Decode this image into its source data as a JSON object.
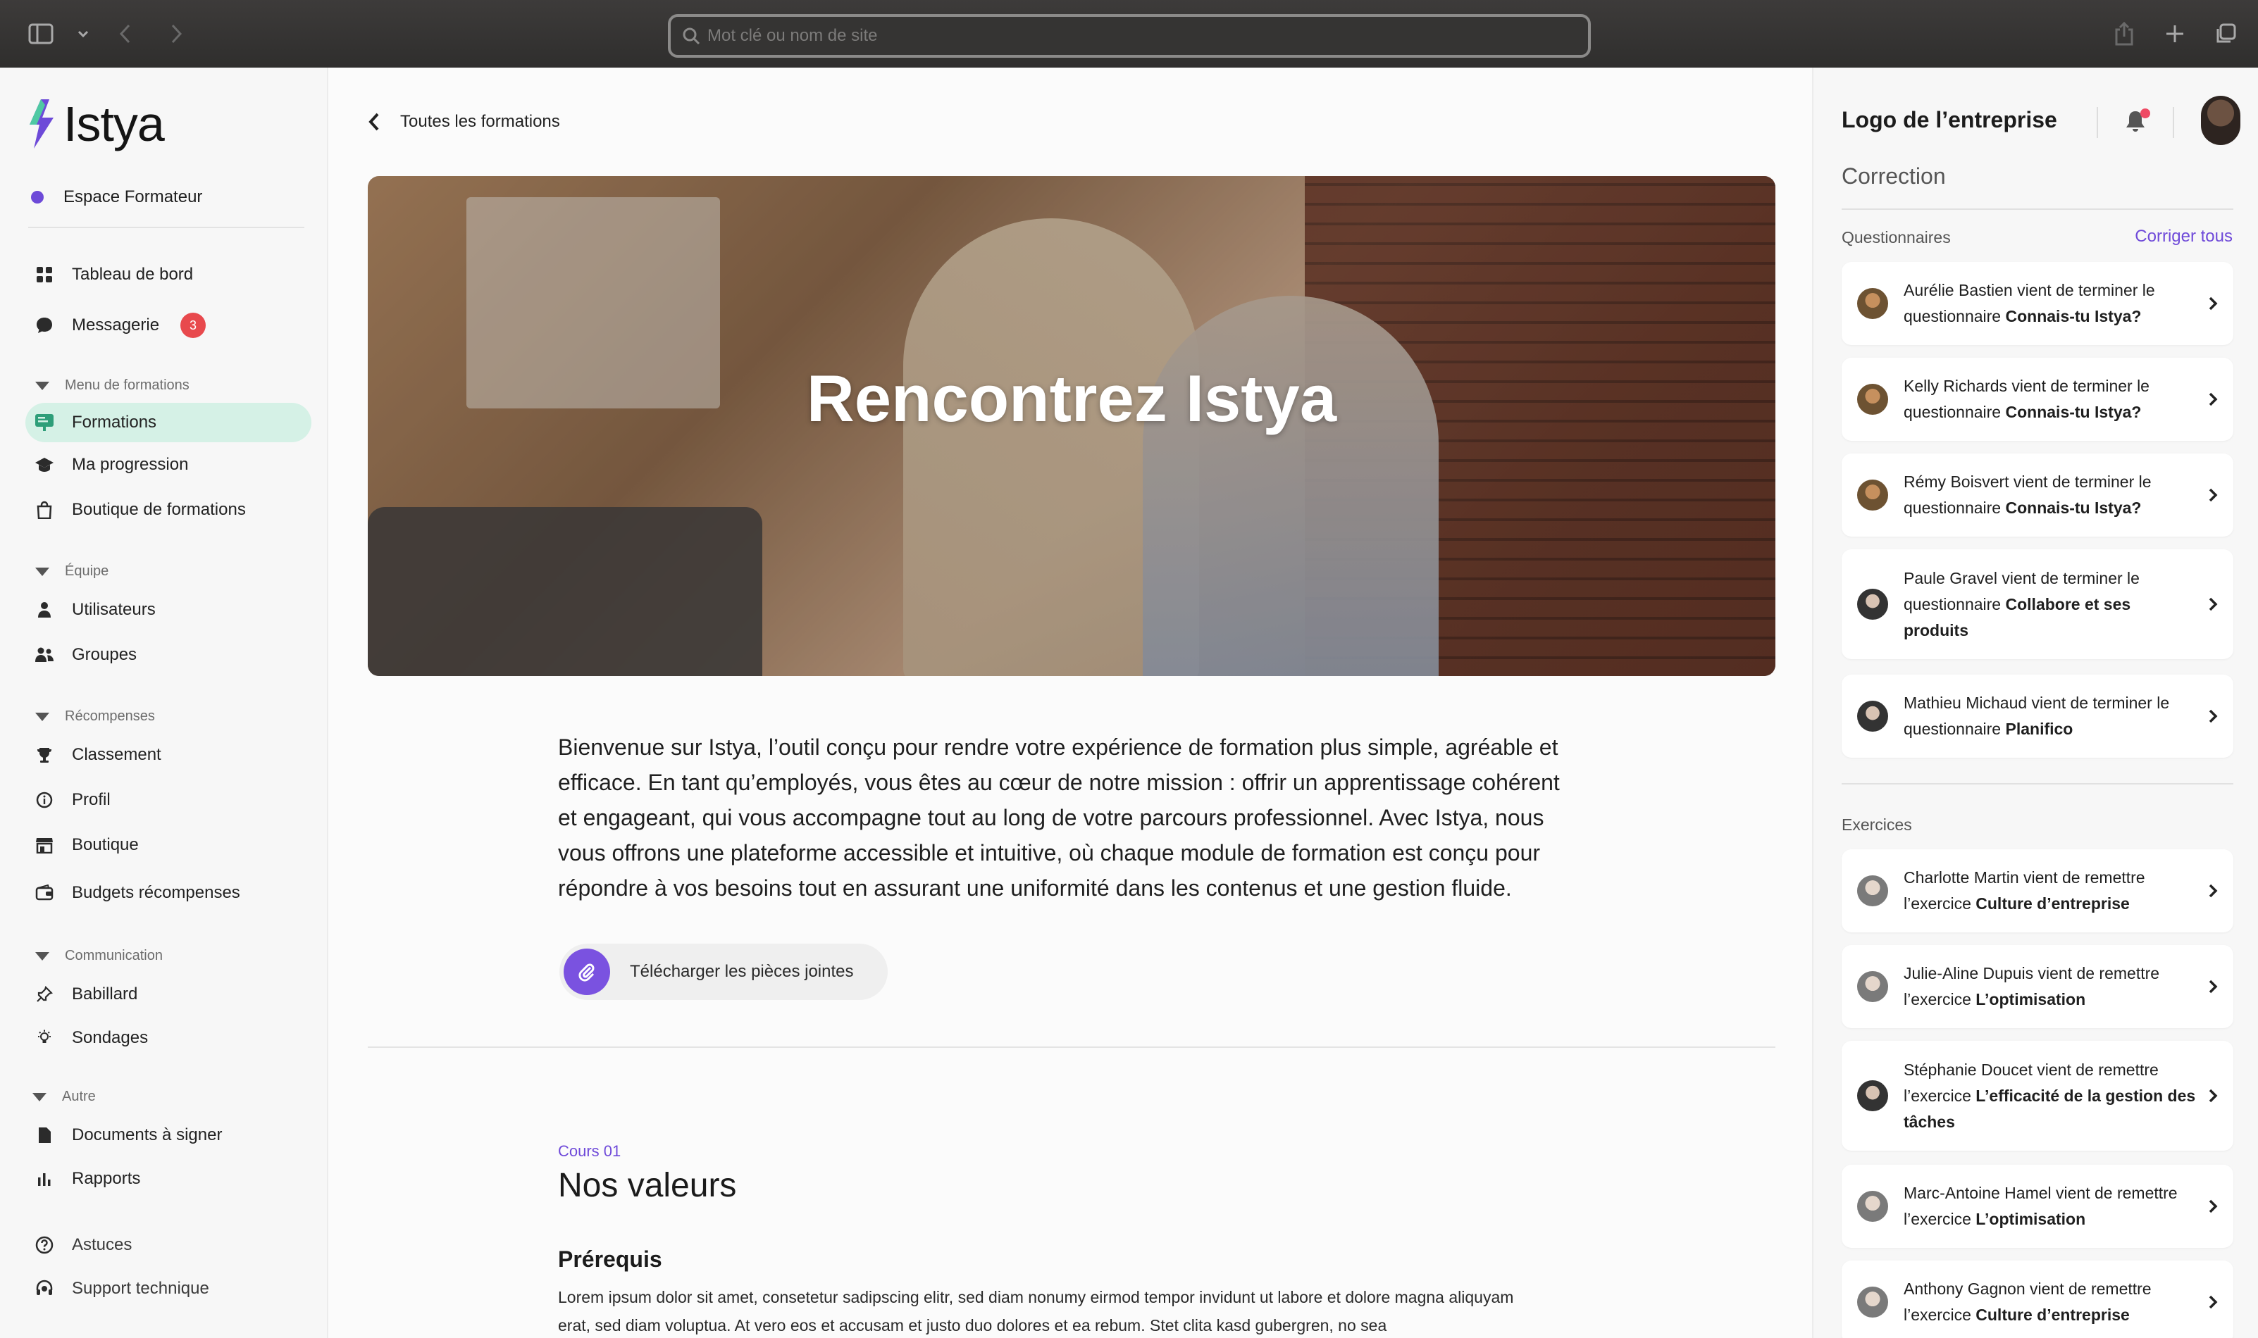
{
  "browser": {
    "address_placeholder": "Mot clé ou nom de site"
  },
  "sidebar": {
    "logo_text": "Istya",
    "space_label": "Espace Formateur",
    "items": {
      "dashboard": "Tableau de bord",
      "messages": "Messagerie",
      "messages_badge": "3",
      "formations": "Formations",
      "progress": "Ma progression",
      "shop_formations": "Boutique de formations",
      "users": "Utilisateurs",
      "groups": "Groupes",
      "ranking": "Classement",
      "profile": "Profil",
      "shop": "Boutique",
      "budgets": "Budgets récompenses",
      "board": "Babillard",
      "surveys": "Sondages",
      "documents": "Documents à signer",
      "reports": "Rapports",
      "tips": "Astuces",
      "support": "Support technique"
    },
    "sections": {
      "formations_menu": "Menu de formations",
      "team": "Équipe",
      "rewards": "Récompenses",
      "communication": "Communication",
      "other": "Autre"
    }
  },
  "main": {
    "back_label": "Toutes les formations",
    "hero_title": "Rencontrez Istya",
    "intro": "Bienvenue sur Istya, l’outil conçu pour rendre votre expérience de formation plus simple, agréable et efficace. En tant qu’employés, vous êtes au cœur de notre mission : offrir un apprentissage cohérent et engageant, qui vous accompagne tout au long de votre parcours professionnel. Avec Istya, nous vous offrons une plateforme accessible et intuitive, où chaque module de formation est conçu pour répondre à vos besoins tout en assurant une uniformité dans les contenus et une gestion fluide.",
    "attach_label": "Télécharger les pièces jointes",
    "course_number": "Cours 01",
    "course_title": "Nos valeurs",
    "prereq_title": "Prérequis",
    "lorem": "Lorem ipsum dolor sit amet, consetetur sadipscing elitr, sed diam nonumy eirmod tempor invidunt ut labore et dolore magna aliquyam erat, sed diam voluptua. At vero eos et accusam et justo duo dolores et ea rebum. Stet clita kasd gubergren, no sea"
  },
  "right_panel": {
    "header": "Logo de l’entreprise",
    "subtitle": "Correction",
    "questionnaires_label": "Questionnaires",
    "correct_all": "Corriger tous",
    "exercises_label": "Exercices",
    "questionnaires": [
      {
        "text": "Aurélie Bastien vient de terminer le questionnaire ",
        "bold": "Connais-tu Istya?"
      },
      {
        "text": "Kelly Richards vient de terminer le questionnaire ",
        "bold": "Connais-tu Istya?"
      },
      {
        "text": "Rémy Boisvert vient de terminer le questionnaire ",
        "bold": "Connais-tu Istya?"
      },
      {
        "text": "Paule Gravel vient de terminer le questionnaire ",
        "bold": "Collabore et ses produits"
      },
      {
        "text": "Mathieu Michaud vient de terminer le questionnaire ",
        "bold": "Planifico"
      }
    ],
    "exercises": [
      {
        "text": "Charlotte Martin vient de remettre l’exercice ",
        "bold": "Culture d’entreprise"
      },
      {
        "text": "Julie-Aline Dupuis vient de remettre l’exercice ",
        "bold": "L’optimisation"
      },
      {
        "text": "Stéphanie Doucet vient de remettre l’exercice ",
        "bold": "L’efficacité de la gestion des tâches"
      },
      {
        "text": "Marc-Antoine Hamel  vient de remettre l’exercice ",
        "bold": "L’optimisation"
      },
      {
        "text": "Anthony Gagnon vient de remettre l’exercice ",
        "bold": "Culture d’entreprise"
      }
    ]
  }
}
